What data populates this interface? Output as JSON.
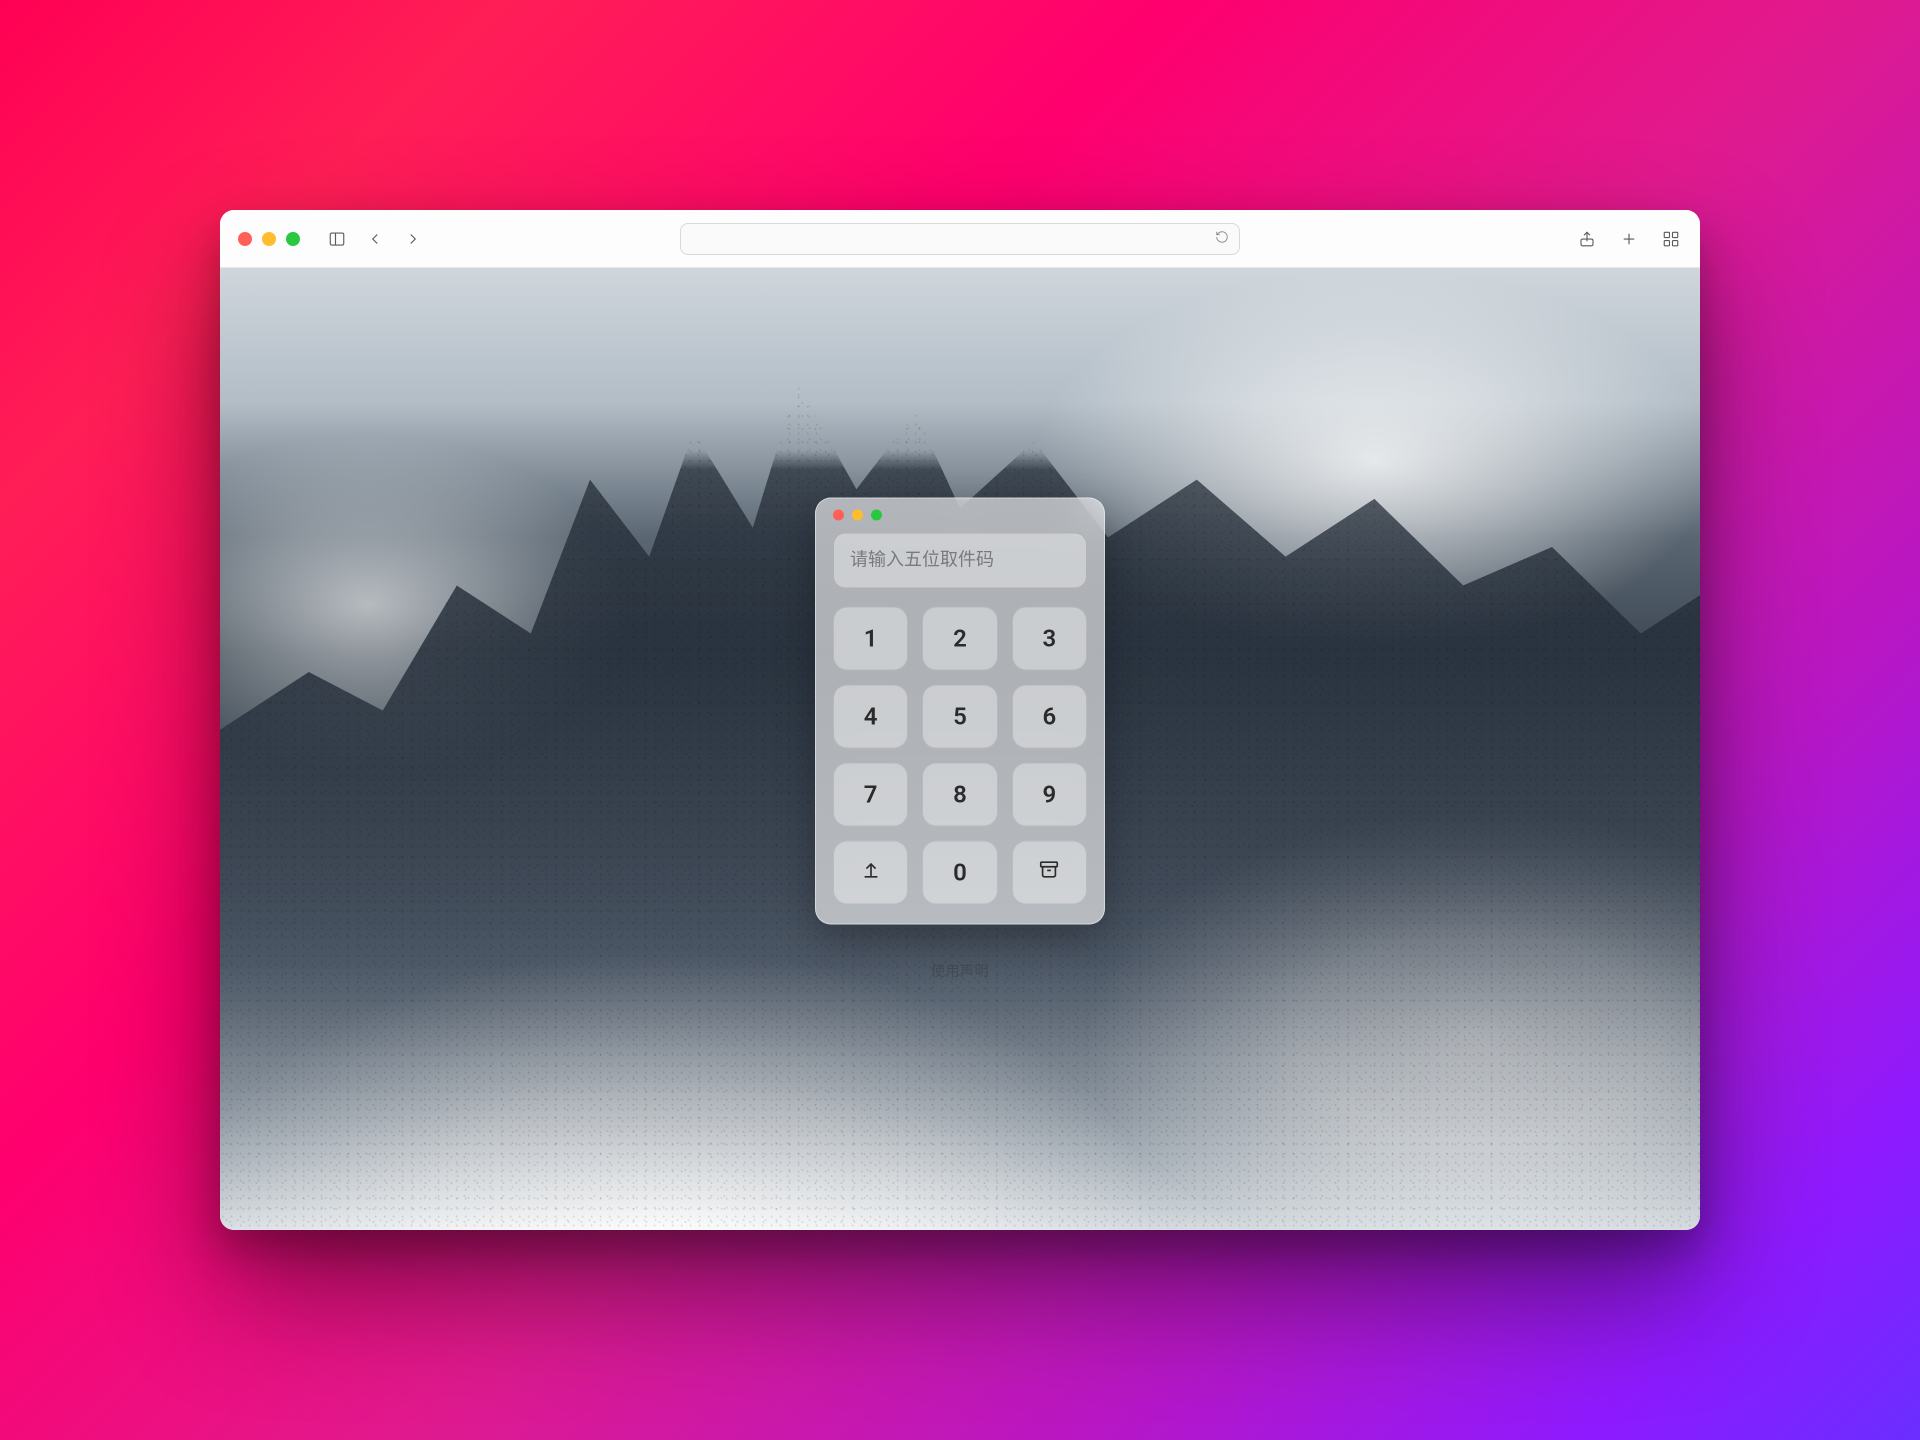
{
  "browser": {
    "address_value": "",
    "address_placeholder": ""
  },
  "panel": {
    "input_placeholder": "请输入五位取件码",
    "input_value": "",
    "keys": [
      "1",
      "2",
      "3",
      "4",
      "5",
      "6",
      "7",
      "8",
      "9",
      "upload",
      "0",
      "archive"
    ]
  },
  "footer": {
    "text": "使用声明"
  },
  "icons": {
    "upload": "upload-icon",
    "archive": "archive-icon"
  }
}
